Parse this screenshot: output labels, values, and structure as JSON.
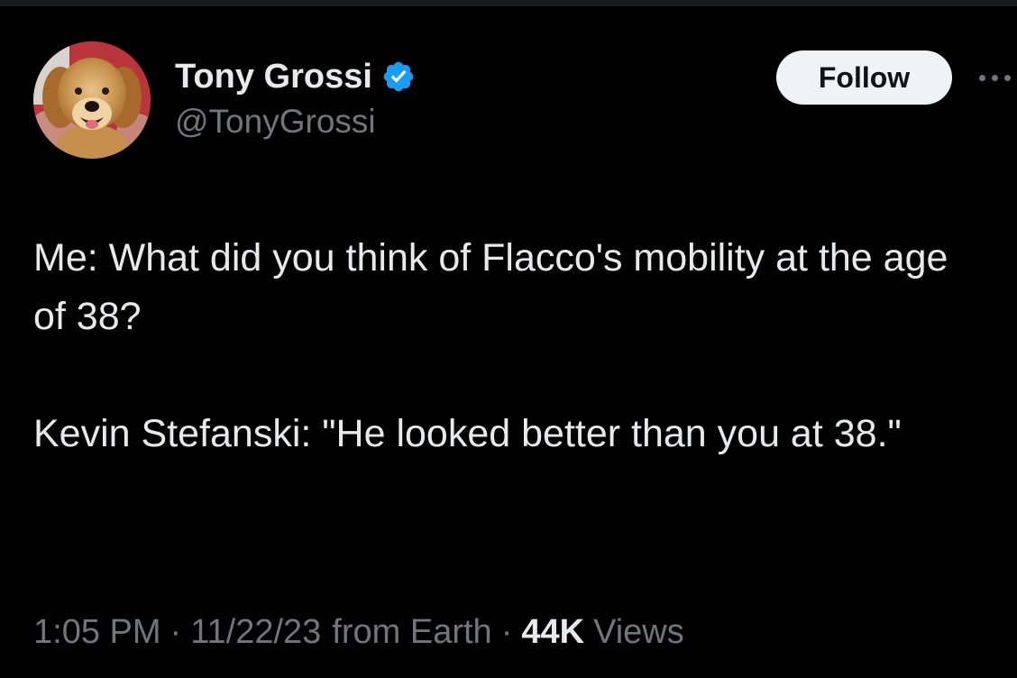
{
  "author": {
    "display_name": "Tony Grossi",
    "handle": "@TonyGrossi",
    "verified": true,
    "verified_color": "#1d9bf0",
    "avatar_icon": "golden-retriever-avatar"
  },
  "actions": {
    "follow_label": "Follow",
    "more_icon": "more-icon"
  },
  "tweet": {
    "paragraph_1": "Me: What did you think of Flacco's mobility at the age of 38?",
    "paragraph_2": "Kevin Stefanski: \"He looked better than you at 38.\""
  },
  "meta": {
    "time": "1:05 PM",
    "separator": "·",
    "date": "11/22/23",
    "source": "from Earth",
    "views_count": "44K",
    "views_label": "Views"
  },
  "colors": {
    "background": "#000000",
    "primary_text": "#e7e9ea",
    "secondary_text": "#71767b",
    "follow_button_bg": "#eff3f4"
  }
}
